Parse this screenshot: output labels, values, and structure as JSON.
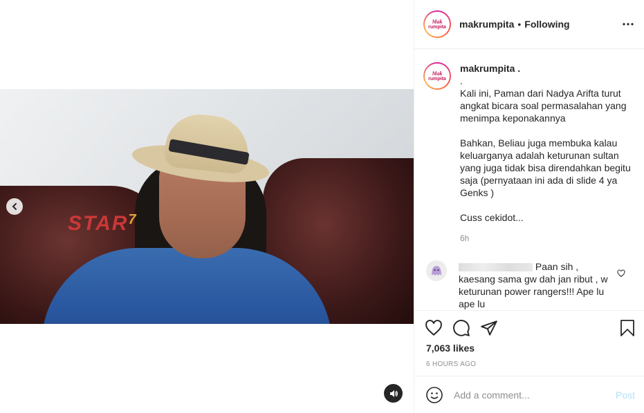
{
  "post": {
    "username": "makrumpita",
    "separator": "•",
    "follow_status": "Following",
    "avatar_text_line1": "Mak",
    "avatar_text_line2": "rumpita",
    "more_icon": "more-horizontal-icon"
  },
  "media": {
    "watermark_main": "STAR",
    "watermark_num": "7",
    "prev_icon": "chevron-left-icon",
    "sound_icon": "speaker-icon"
  },
  "caption": {
    "username": "makrumpita .",
    "text": ".\nKali ini, Paman dari Nadya Arifta turut angkat bicara soal permasalahan yang menimpa keponakannya\n\nBahkan, Beliau juga membuka kalau keluarganya adalah keturunan sultan yang juga tidak bisa direndahkan begitu saja (pernyataan ini ada di slide 4 ya Genks )\n\nCuss cekidot...",
    "time": "6h"
  },
  "comments": [
    {
      "text": " Paan sih ,\nkaesang sama gw dah jan ribut , w keturunan power rangers!!! Ape lu ape lu",
      "heart_icon": "heart-outline-icon"
    }
  ],
  "actions": {
    "like_icon": "heart-icon",
    "comment_icon": "comment-icon",
    "share_icon": "send-icon",
    "save_icon": "bookmark-icon",
    "likes": "7,063 likes",
    "time_ago": "6 HOURS AGO"
  },
  "add_comment": {
    "placeholder": "Add a comment...",
    "post_label": "Post",
    "emoji_icon": "emoji-icon"
  }
}
